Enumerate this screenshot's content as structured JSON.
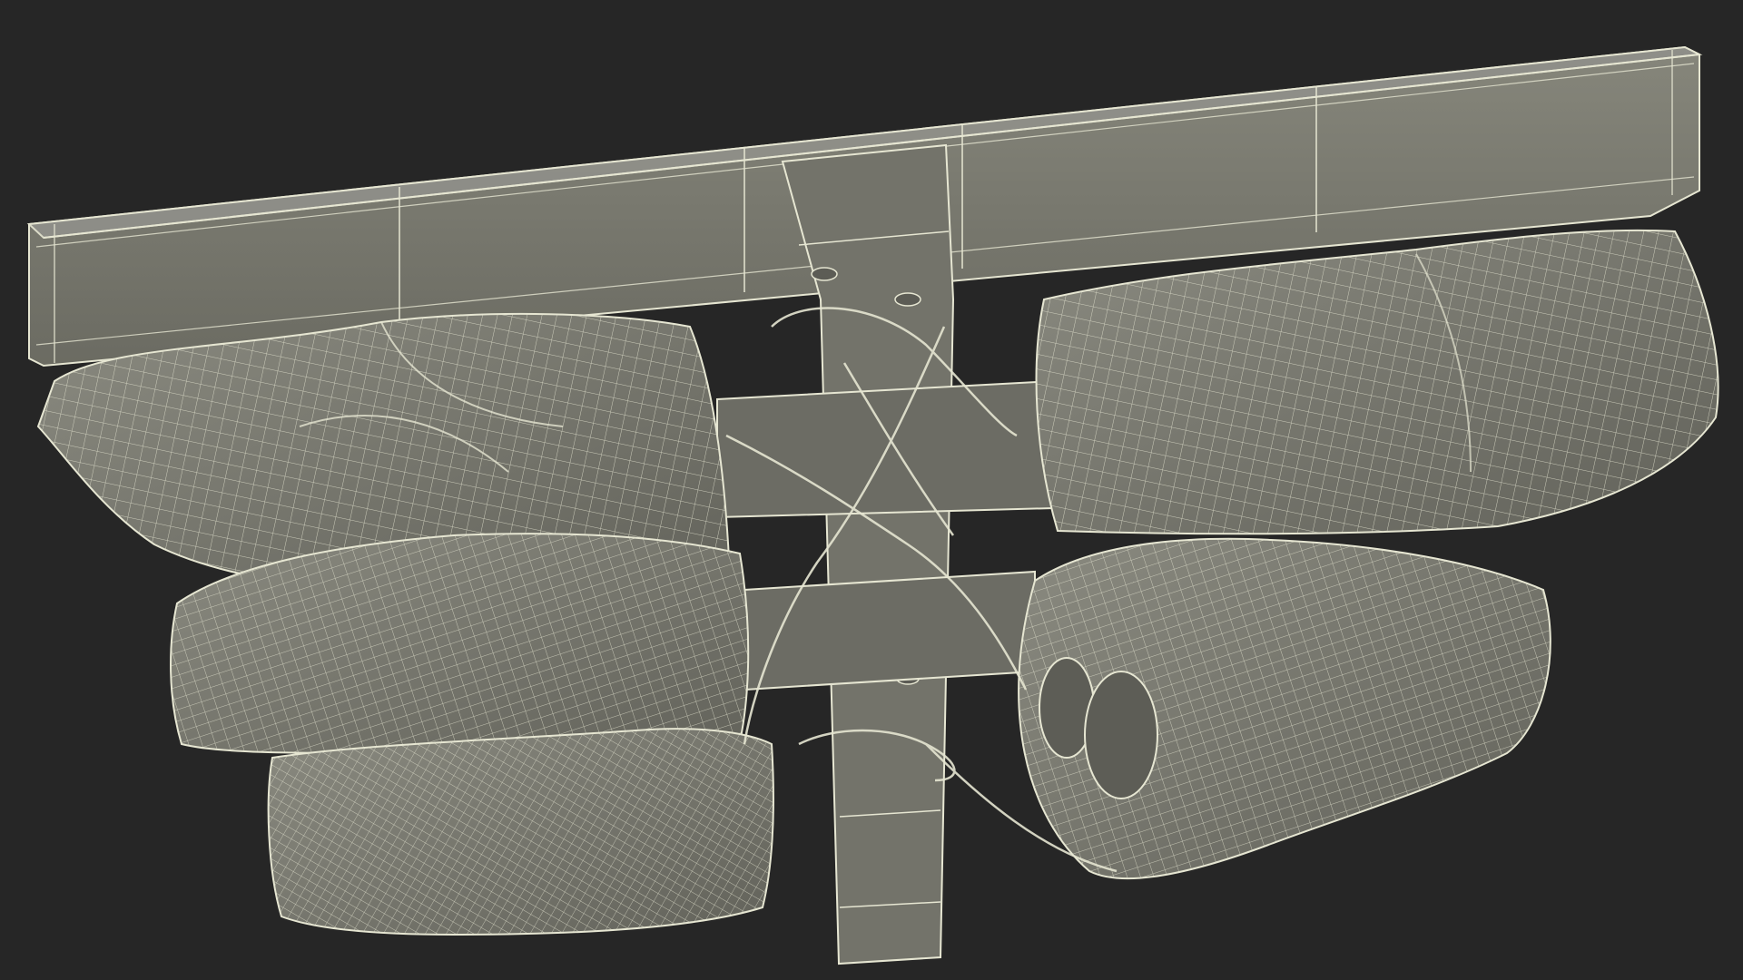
{
  "scene": {
    "background_color": "#262626",
    "mesh_fill_color": "#7a7a70",
    "mesh_shade_color": "#5f5f57",
    "wire_color": "#e6e6d2",
    "subject": "wireframe-3d-model"
  }
}
